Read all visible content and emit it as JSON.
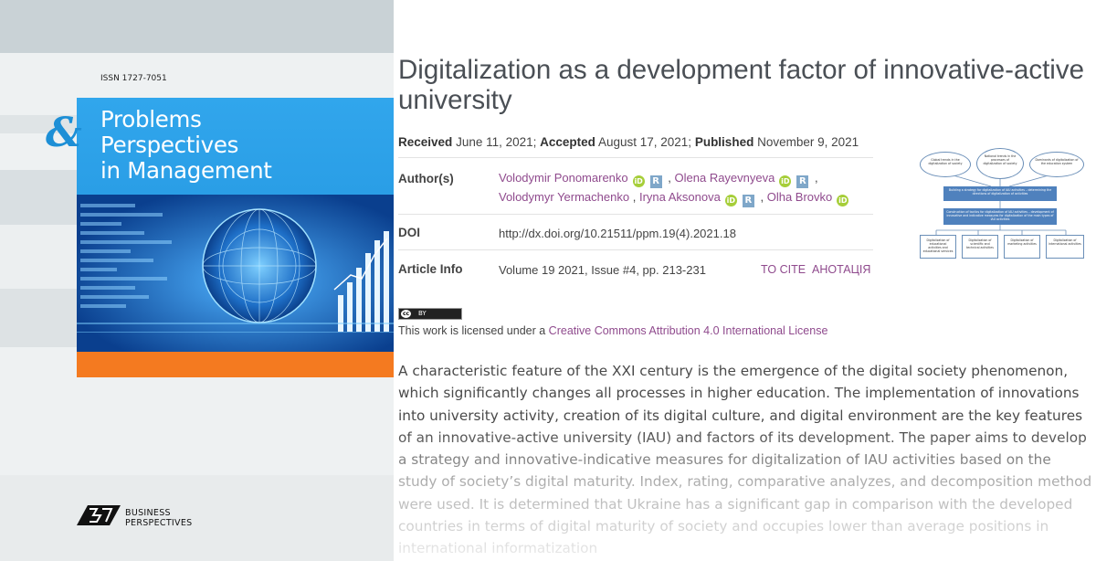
{
  "cover": {
    "issn": "ISSN 1727-7051",
    "amp": "&",
    "title_lines": [
      "Problems",
      "Perspectives",
      "in Management"
    ],
    "publisher_lines": [
      "BUSINESS",
      "PERSPECTIVES"
    ],
    "colors": {
      "blue": "#2a9ee6",
      "navy": "#0a3f8e",
      "orange": "#f47a20"
    }
  },
  "article": {
    "title": "Digitalization as a development factor of innovative-active university",
    "dates": {
      "received_label": "Received",
      "received": "June 11, 2021;",
      "accepted_label": "Accepted",
      "accepted": "August 17, 2021;",
      "published_label": "Published",
      "published": "November 9, 2021"
    },
    "authors_label": "Author(s)",
    "authors": [
      {
        "name": "Volodymir Ponomarenko"
      },
      {
        "name": "Olena Rayevnyeva"
      },
      {
        "name": "Volodymyr Yermachenko"
      },
      {
        "name": "Iryna Aksonova"
      },
      {
        "name": "Olha Brovko"
      }
    ],
    "orcid_glyph": "iD",
    "rg_glyph": "R",
    "separator": ",",
    "doi_label": "DOI",
    "doi": "http://dx.doi.org/10.21511/ppm.19(4).2021.18",
    "info_label": "Article Info",
    "info": "Volume 19 2021, Issue #4, pp. 213-231",
    "to_cite": "TO CITE",
    "anotatsiya": "АНОТАЦІЯ",
    "license_badge": {
      "cc": "cc",
      "by": "BY"
    },
    "license_prefix": "This work is licensed under a",
    "license_link": "Creative Commons Attribution 4.0 International License",
    "abstract": "A characteristic feature of the XXI century is the emergence of the digital society phenomenon, which significantly changes all processes in higher education. The implementation of innovations into university activity, creation of its digital culture, and digital environment are the key features of an innovative-active university (IAU) and factors of its development. The paper aims to develop a strategy and innovative-indicative measures for digitalization of IAU activities based on the study of society’s digital maturity. Index, rating, comparative analyzes, and decomposition method were used. It is determined that Ukraine has a significant gap in comparison with the developed countries in terms of digital maturity of society and occupies lower than average positions in international informatization",
    "colors": {
      "link": "#8f4a8d",
      "text": "#444444",
      "orcid": "#a6ce39"
    }
  },
  "graphical_abstract": {
    "ovals": [
      "Global trends in the digitalization of society",
      "National trends in the processes of digitalization of society",
      "Dominants of digitalization of the education system"
    ],
    "box1": "Building a strategy for digitalization of IAU activities – determining the directions of digitalization of activities",
    "box2": "Construction of tactics for digitalization of IAU activities – development of innovative and indicative measures for digitalization of the main types of IAU activities",
    "bottom": [
      "Digitalization of educational activities and educational services",
      "Digitalization of scientific and technical activities",
      "Digitalization of marketing activities",
      "Digitalization of international activities"
    ]
  }
}
